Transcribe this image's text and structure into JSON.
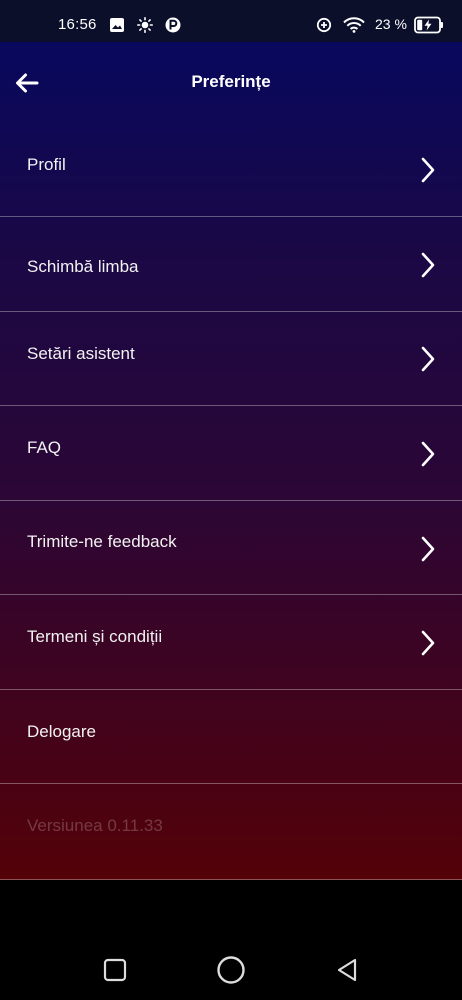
{
  "status_bar": {
    "time": "16:56",
    "battery": "23 %",
    "icons": [
      "image-icon",
      "brightness-icon",
      "parking-app-icon",
      "data-saver-icon",
      "wifi-icon",
      "battery-charging-icon"
    ]
  },
  "app_bar": {
    "title": "Preferințe",
    "back_icon": "arrow-left-icon"
  },
  "menu": {
    "items": [
      {
        "label": "Profil",
        "has_chevron": true
      },
      {
        "label": "Schimbă limba",
        "has_chevron": true
      },
      {
        "label": "Setări asistent",
        "has_chevron": true
      },
      {
        "label": "FAQ",
        "has_chevron": true
      },
      {
        "label": "Trimite-ne feedback",
        "has_chevron": true
      },
      {
        "label": "Termeni și condiții",
        "has_chevron": true
      },
      {
        "label": "Delogare",
        "has_chevron": false
      }
    ],
    "version": "Versiunea 0.11.33"
  },
  "nav_bar": {
    "buttons": [
      "recents-square-icon",
      "home-circle-icon",
      "back-triangle-icon"
    ]
  },
  "colors": {
    "gradient_top": "#08085e",
    "gradient_bottom": "#540108",
    "divider": "#ffffff55"
  }
}
